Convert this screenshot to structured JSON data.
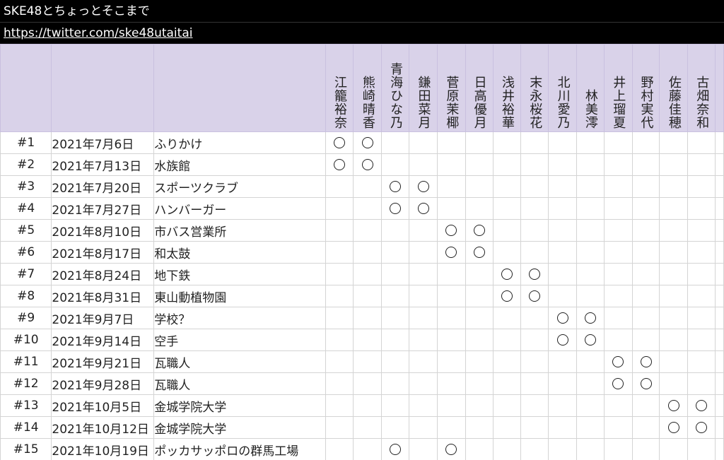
{
  "sheet": {
    "title": "SKE48とちょっとそこまで",
    "url": "https://twitter.com/ske48utaitai"
  },
  "members": [
    "江籠裕奈",
    "熊崎晴香",
    "青海ひな乃",
    "鎌田菜月",
    "菅原茉椰",
    "日高優月",
    "浅井裕華",
    "末永桜花",
    "北川愛乃",
    "林美澪",
    "井上瑠夏",
    "野村実代",
    "佐藤佳穂",
    "古畑奈和"
  ],
  "mark_symbol": "○",
  "episodes": [
    {
      "ep": "#1",
      "date": "2021年7月6日",
      "title": "ふりかけ",
      "members": [
        0,
        1
      ]
    },
    {
      "ep": "#2",
      "date": "2021年7月13日",
      "title": "水族館",
      "members": [
        0,
        1
      ]
    },
    {
      "ep": "#3",
      "date": "2021年7月20日",
      "title": "スポーツクラブ",
      "members": [
        2,
        3
      ]
    },
    {
      "ep": "#4",
      "date": "2021年7月27日",
      "title": "ハンバーガー",
      "members": [
        2,
        3
      ]
    },
    {
      "ep": "#5",
      "date": "2021年8月10日",
      "title": "市バス営業所",
      "members": [
        4,
        5
      ]
    },
    {
      "ep": "#6",
      "date": "2021年8月17日",
      "title": "和太鼓",
      "members": [
        4,
        5
      ]
    },
    {
      "ep": "#7",
      "date": "2021年8月24日",
      "title": "地下鉄",
      "members": [
        6,
        7
      ]
    },
    {
      "ep": "#8",
      "date": "2021年8月31日",
      "title": "東山動植物園",
      "members": [
        6,
        7
      ]
    },
    {
      "ep": "#9",
      "date": "2021年9月7日",
      "title": "学校？",
      "members": [
        8,
        9
      ]
    },
    {
      "ep": "#10",
      "date": "2021年9月14日",
      "title": "空手",
      "members": [
        8,
        9
      ]
    },
    {
      "ep": "#11",
      "date": "2021年9月21日",
      "title": "瓦職人",
      "members": [
        10,
        11
      ]
    },
    {
      "ep": "#12",
      "date": "2021年9月28日",
      "title": "瓦職人",
      "members": [
        10,
        11
      ]
    },
    {
      "ep": "#13",
      "date": "2021年10月5日",
      "title": "金城学院大学",
      "members": [
        12,
        13
      ]
    },
    {
      "ep": "#14",
      "date": "2021年10月12日",
      "title": "金城学院大学",
      "members": [
        12,
        13
      ]
    },
    {
      "ep": "#15",
      "date": "2021年10月19日",
      "title": "ポッカサッポロの群馬工場",
      "members": [
        2,
        4
      ]
    }
  ]
}
